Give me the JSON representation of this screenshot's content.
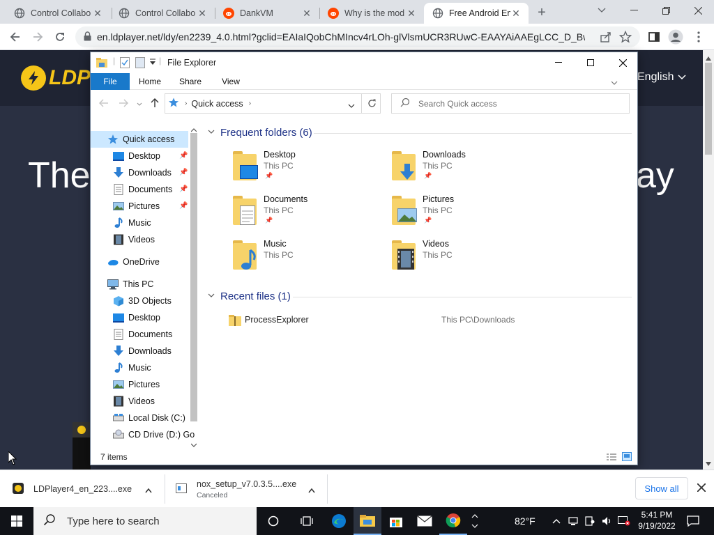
{
  "browser": {
    "tabs": [
      {
        "title": "Control Collabo",
        "favicon": "globe-icon",
        "active": false
      },
      {
        "title": "Control Collabo",
        "favicon": "globe-icon",
        "active": false
      },
      {
        "title": "DankVM",
        "favicon": "reddit-icon",
        "active": false
      },
      {
        "title": "Why is the mod",
        "favicon": "reddit-icon",
        "active": false
      },
      {
        "title": "Free Android Em",
        "favicon": "globe-icon",
        "active": true
      }
    ],
    "new_tab": "+",
    "url": "en.ldplayer.net/ldy/en2239_4.0.html?gclid=EAIaIQobChMIncv4rLOh-glVlsmUCR3RUwC-EAAYAiAAEgLCC_D_BwE"
  },
  "page": {
    "logo_text": "LDP",
    "headline_left": "The",
    "headline_right": "ay",
    "language": "English",
    "help": "?"
  },
  "downloads": [
    {
      "name": "LDPlayer4_en_223....exe",
      "status": ""
    },
    {
      "name": "nox_setup_v7.0.3.5....exe",
      "status": "Canceled"
    }
  ],
  "show_all": "Show all",
  "explorer": {
    "title": "File Explorer",
    "ribbon_tabs": [
      "File",
      "Home",
      "Share",
      "View"
    ],
    "address": "Quick access",
    "search_placeholder": "Search Quick access",
    "nav": [
      {
        "label": "Quick access",
        "icon": "star-icon",
        "pinned": false,
        "selected": true,
        "indent": 0
      },
      {
        "label": "Desktop",
        "icon": "desktop-icon",
        "pinned": true,
        "indent": 1
      },
      {
        "label": "Downloads",
        "icon": "download-arrow-icon",
        "pinned": true,
        "indent": 1
      },
      {
        "label": "Documents",
        "icon": "document-icon",
        "pinned": true,
        "indent": 1
      },
      {
        "label": "Pictures",
        "icon": "picture-icon",
        "pinned": true,
        "indent": 1
      },
      {
        "label": "Music",
        "icon": "music-note-icon",
        "pinned": false,
        "indent": 1
      },
      {
        "label": "Videos",
        "icon": "film-icon",
        "pinned": false,
        "indent": 1
      },
      {
        "label": "OneDrive",
        "icon": "cloud-icon",
        "pinned": false,
        "indent": 0
      },
      {
        "label": "This PC",
        "icon": "computer-icon",
        "pinned": false,
        "indent": 0
      },
      {
        "label": "3D Objects",
        "icon": "cube-icon",
        "pinned": false,
        "indent": 1
      },
      {
        "label": "Desktop",
        "icon": "desktop-icon",
        "pinned": false,
        "indent": 1
      },
      {
        "label": "Documents",
        "icon": "document-icon",
        "pinned": false,
        "indent": 1
      },
      {
        "label": "Downloads",
        "icon": "download-arrow-icon",
        "pinned": false,
        "indent": 1
      },
      {
        "label": "Music",
        "icon": "music-note-icon",
        "pinned": false,
        "indent": 1
      },
      {
        "label": "Pictures",
        "icon": "picture-icon",
        "pinned": false,
        "indent": 1
      },
      {
        "label": "Videos",
        "icon": "film-icon",
        "pinned": false,
        "indent": 1
      },
      {
        "label": "Local Disk (C:)",
        "icon": "drive-icon",
        "pinned": false,
        "indent": 1
      },
      {
        "label": "CD Drive (D:) Go",
        "icon": "cd-drive-icon",
        "pinned": false,
        "indent": 1
      }
    ],
    "frequent_title": "Frequent folders (6)",
    "folders": [
      {
        "name": "Desktop",
        "location": "This PC",
        "pinned": true,
        "overlay": "desktop"
      },
      {
        "name": "Downloads",
        "location": "This PC",
        "pinned": true,
        "overlay": "download"
      },
      {
        "name": "Documents",
        "location": "This PC",
        "pinned": true,
        "overlay": "document"
      },
      {
        "name": "Pictures",
        "location": "This PC",
        "pinned": true,
        "overlay": "picture"
      },
      {
        "name": "Music",
        "location": "This PC",
        "pinned": false,
        "overlay": "music"
      },
      {
        "name": "Videos",
        "location": "This PC",
        "pinned": false,
        "overlay": "film"
      }
    ],
    "recent_title": "Recent files (1)",
    "recent": [
      {
        "name": "ProcessExplorer",
        "path": "This PC\\Downloads"
      }
    ],
    "status": "7 items"
  },
  "taskbar": {
    "search_placeholder": "Type here to search",
    "temperature": "82°F",
    "time": "5:41 PM",
    "date": "9/19/2022"
  },
  "colors": {
    "accent": "#1979ca",
    "folder": "#f7d36a",
    "ldplayer_yellow": "#f5c518",
    "page_bg": "#1d2130"
  }
}
